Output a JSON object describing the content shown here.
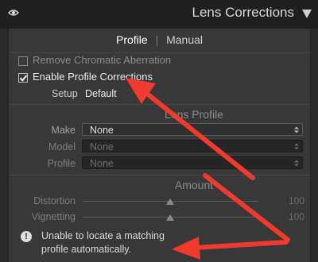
{
  "header": {
    "title": "Lens Corrections",
    "visibility_icon": "eye-icon",
    "collapse_icon": "triangle-down-icon"
  },
  "tabs": [
    {
      "label": "Profile",
      "active": true
    },
    {
      "label": "Manual",
      "active": false
    }
  ],
  "options": {
    "remove_ca": {
      "label": "Remove Chromatic Aberration",
      "checked": false
    },
    "enable_profile": {
      "label": "Enable Profile Corrections",
      "checked": true
    }
  },
  "setup": {
    "label": "Setup",
    "value": "Default"
  },
  "lens_profile": {
    "title": "Lens Profile",
    "make": {
      "label": "Make",
      "value": "None"
    },
    "model": {
      "label": "Model",
      "value": "None"
    },
    "profile": {
      "label": "Profile",
      "value": "None"
    }
  },
  "amount": {
    "title": "Amount",
    "distortion": {
      "label": "Distortion",
      "value": "100",
      "level": 0.5
    },
    "vignetting": {
      "label": "Vignetting",
      "value": "100",
      "level": 0.5
    }
  },
  "warning": {
    "icon": "exclamation-icon",
    "line1": "Unable to locate a matching",
    "line2": "profile automatically."
  },
  "annotation_color": "#f03a2e",
  "colors": {
    "header_bg": "#1f1f1f",
    "panel_bg": "#383838"
  }
}
